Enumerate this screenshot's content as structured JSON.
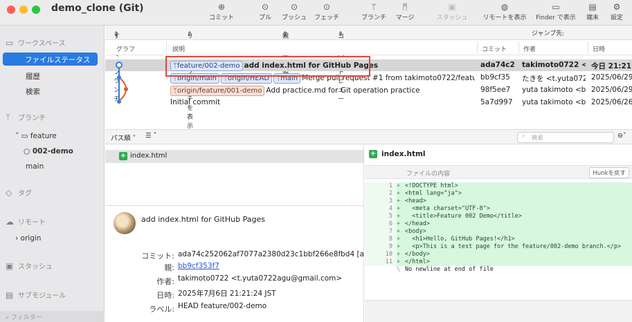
{
  "window": {
    "title": "demo_clone (Git)"
  },
  "toolbar": {
    "items": [
      {
        "label": "コミット",
        "icon": "plus-circle-icon"
      },
      {
        "label": "プル",
        "icon": "arrow-down-circle-icon"
      },
      {
        "label": "プッシュ",
        "icon": "arrow-up-circle-icon"
      },
      {
        "label": "フェッチ",
        "icon": "download-circle-icon"
      },
      {
        "label": "ブランチ",
        "icon": "branch-icon"
      },
      {
        "label": "マージ",
        "icon": "merge-icon"
      },
      {
        "label": "スタッシュ",
        "icon": "stash-icon"
      },
      {
        "label": "リモートを表示",
        "icon": "globe-icon"
      },
      {
        "label": "Finder で表示",
        "icon": "folder-icon"
      },
      {
        "label": "端末",
        "icon": "terminal-icon"
      },
      {
        "label": "設定",
        "icon": "gear-icon"
      }
    ]
  },
  "sidebar": {
    "workspace_label": "ワークスペース",
    "items": [
      "ファイルステータス",
      "履歴",
      "検索"
    ],
    "branch_label": "ブランチ",
    "branch_folder": "feature",
    "branch_current": "002-demo",
    "branch_main": "main",
    "tag_label": "タグ",
    "remote_label": "リモート",
    "remote_origin": "origin",
    "stash_label": "スタッシュ",
    "submodule_label": "サブモジュール",
    "filter_placeholder": "フィルター"
  },
  "filterbar": {
    "branches": "すべてのブランチ",
    "remote": "リモートブランチを表示",
    "parent": "親子関係順",
    "compact": "コンパクトビュー",
    "jump": "ジャンプ先:"
  },
  "columns": {
    "graph": "グラフ",
    "desc": "説明",
    "commit": "コミット",
    "author": "作者",
    "date": "日時"
  },
  "commits": [
    {
      "refs": [
        "feature/002-demo"
      ],
      "remote_refs": [],
      "message": "add index.html for GitHub Pages",
      "hash": "ada74c2",
      "author": "takimoto0722 <...",
      "date": "今日 21:21"
    },
    {
      "refs": [
        "origin/main",
        "origin/HEAD",
        "main"
      ],
      "remote_refs": [],
      "message": "Merge pull request #1 from takimoto0722/featur...",
      "hash": "bb9cf35",
      "author": "たきを <t.yuta072...",
      "date": "2025/06/29"
    },
    {
      "refs": [],
      "remote_refs": [
        "origin/feature/001-demo"
      ],
      "message": "Add practice.md for Git operation practice",
      "hash": "98f5ee7",
      "author": "yuta takimoto <b...",
      "date": "2025/06/29"
    },
    {
      "refs": [],
      "remote_refs": [],
      "message": "Initial commit",
      "hash": "5a7d997",
      "author": "yuta takimoto <b...",
      "date": "2025/06/26"
    }
  ],
  "midbar": {
    "path_view": "パス順",
    "search_placeholder": "検索"
  },
  "files": [
    "index.html"
  ],
  "details": {
    "message": "add index.html for GitHub Pages",
    "commit_label": "コミット:",
    "commit_value": "ada74c252062af7077a2380d23c1bbf266e8fbd4 [ad",
    "parent_label": "親:",
    "parent_value": "bb9cf353f7",
    "author_label": "作者:",
    "author_value": "takimoto0722 <t.yuta0722agu@gmail.com>",
    "date_label": "日時:",
    "date_value": "2025年7月6日 21:21:24 JST",
    "labels_label": "ラベル:",
    "labels_value": "HEAD feature/002-demo"
  },
  "diff": {
    "file": "index.html",
    "header": "ファイルの内容",
    "hunk_button": "Hunkを戻す",
    "lines": [
      {
        "n": "1",
        "t": "<!DOCTYPE html>"
      },
      {
        "n": "2",
        "t": "<html lang=\"ja\">"
      },
      {
        "n": "3",
        "t": "<head>"
      },
      {
        "n": "4",
        "t": "  <meta charset=\"UTF-8\">"
      },
      {
        "n": "5",
        "t": "  <title>Feature 002 Demo</title>"
      },
      {
        "n": "6",
        "t": "</head>"
      },
      {
        "n": "7",
        "t": "<body>"
      },
      {
        "n": "8",
        "t": "  <h1>Hello, GitHub Pages!</h1>"
      },
      {
        "n": "9",
        "t": "  <p>This is a test page for the feature/002-demo branch.</p>"
      },
      {
        "n": "10",
        "t": "</body>"
      },
      {
        "n": "11",
        "t": "</html>"
      }
    ],
    "no_newline": "No newline at end of file"
  }
}
